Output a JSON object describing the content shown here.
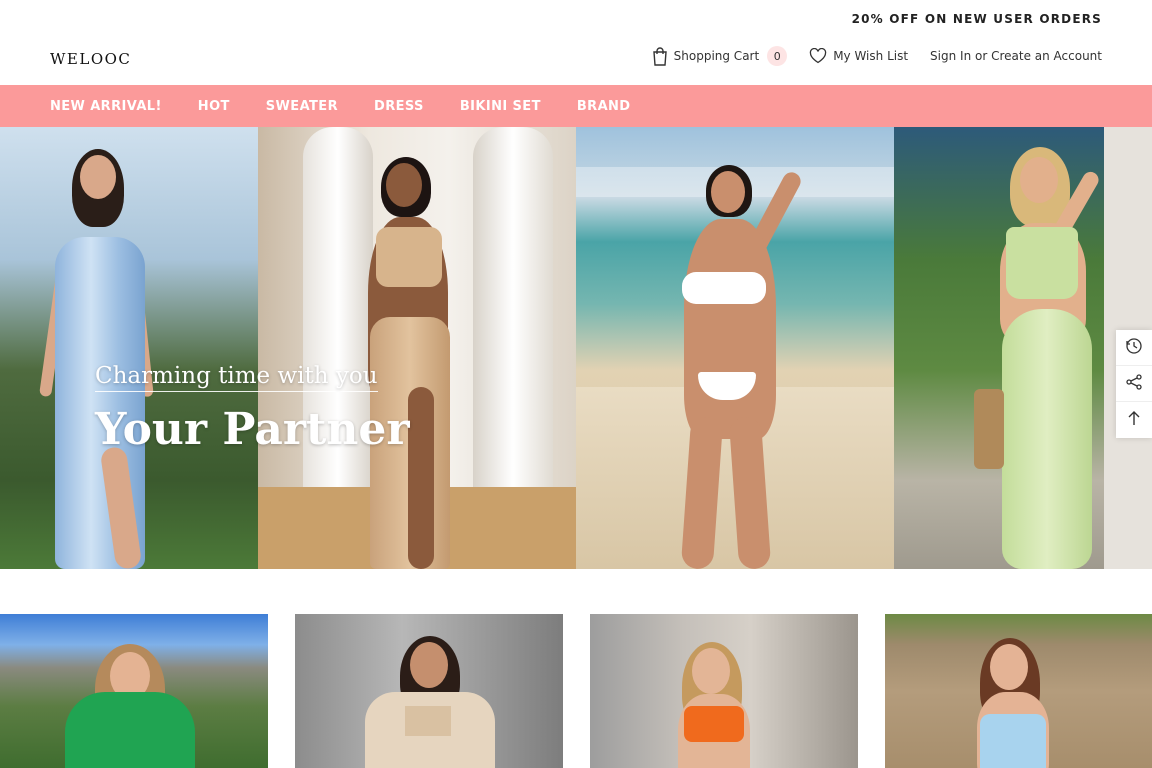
{
  "promo": {
    "text": "20% OFF ON NEW USER ORDERS"
  },
  "header": {
    "logo": "WELOOC",
    "cart_label": "Shopping Cart",
    "cart_count": "0",
    "wishlist_label": "My Wish List",
    "account_label": "Sign In or Create an Account"
  },
  "nav": {
    "items": [
      {
        "label": "NEW ARRIVAL!"
      },
      {
        "label": "HOT"
      },
      {
        "label": "SWEATER"
      },
      {
        "label": "DRESS"
      },
      {
        "label": "BIKINI SET"
      },
      {
        "label": "BRAND"
      }
    ]
  },
  "hero": {
    "subtitle": "Charming time with you",
    "title": "Your Partner"
  },
  "side_tools": {
    "icons": [
      "history-icon",
      "share-icon",
      "back-to-top-icon"
    ]
  },
  "colors": {
    "nav_bg": "#fb9a9a",
    "cart_badge_bg": "#fde4e4"
  }
}
